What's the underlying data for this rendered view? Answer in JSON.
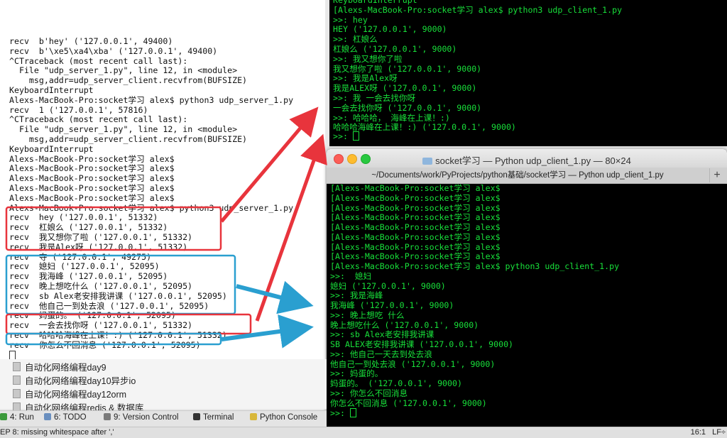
{
  "server": {
    "lines": [
      "recv  b'hey' ('127.0.0.1', 49400)",
      "recv  b'\\xe5\\xa4\\xba' ('127.0.0.1', 49400)",
      "^CTraceback (most recent call last):",
      "  File \"udp_server_1.py\", line 12, in <module>",
      "    msg,addr=udp_server_client.recvfrom(BUFSIZE)",
      "KeyboardInterrupt",
      "Alexs-MacBook-Pro:socket学习 alex$ python3 udp_server_1.py",
      "recv  1 ('127.0.0.1', 57816)",
      "^CTraceback (most recent call last):",
      "  File \"udp_server_1.py\", line 12, in <module>",
      "    msg,addr=udp_server_client.recvfrom(BUFSIZE)",
      "KeyboardInterrupt",
      "Alexs-MacBook-Pro:socket学习 alex$",
      "Alexs-MacBook-Pro:socket学习 alex$",
      "Alexs-MacBook-Pro:socket学习 alex$",
      "Alexs-MacBook-Pro:socket学习 alex$",
      "Alexs-MacBook-Pro:socket学习 alex$",
      "Alexs-MacBook-Pro:socket学习 alex$ python3 udp_server_1.py",
      "recv  hey ('127.0.0.1', 51332)",
      "recv  杠娘么 ('127.0.0.1', 51332)",
      "recv  我又想你了啦 ('127.0.0.1', 51332)",
      "recv  我是Alex呀 ('127.0.0.1', 51332)",
      "recv  夺 ('127.0.0.1', 49275)",
      "recv  媳妇 ('127.0.0.1', 52095)",
      "recv  我海峰 ('127.0.0.1', 52095)",
      "recv  晚上想吃什么 ('127.0.0.1', 52095)",
      "recv  sb Alex老安排我讲课 ('127.0.0.1', 52095)",
      "recv  他自己一到处去浪 ('127.0.0.1', 52095)",
      "recv  妈蛋的。 ('127.0.0.1', 52095)",
      "recv  一会去找你呀 ('127.0.0.1', 51332)",
      "recv  哈哈哈海峰在上课！:) ('127.0.0.1', 51332)",
      "recv  你怎么不回消息 ('127.0.0.1', 52095)"
    ]
  },
  "client1": {
    "lines": [
      "KeyboardInterrupt",
      "[Alexs-MacBook-Pro:socket学习 alex$ python3 udp_client_1.py",
      ">>: hey",
      "HEY ('127.0.0.1', 9000)",
      ">>: 杠娘么",
      "杠娘么 ('127.0.0.1', 9000)",
      ">>: 我又想你了啦",
      "我又想你了啦 ('127.0.0.1', 9000)",
      ">>: 我是Alex呀",
      "我是ALEX呀 ('127.0.0.1', 9000)",
      ">>: 我 一会去找你呀",
      "一会去找你呀 ('127.0.0.1', 9000)",
      ">>: 哈哈哈， 海峰在上课！:)",
      "哈哈哈海峰在上课！:) ('127.0.0.1', 9000)"
    ],
    "prompt": ">>: "
  },
  "client2": {
    "title": "socket学习 — Python udp_client_1.py — 80×24",
    "tab": "~/Documents/work/PyProjects/python基础/socket学习 — Python udp_client_1.py",
    "plus": "+",
    "lines": [
      "[Alexs-MacBook-Pro:socket学习 alex$",
      "[Alexs-MacBook-Pro:socket学习 alex$",
      "[Alexs-MacBook-Pro:socket学习 alex$",
      "[Alexs-MacBook-Pro:socket学习 alex$",
      "[Alexs-MacBook-Pro:socket学习 alex$",
      "[Alexs-MacBook-Pro:socket学习 alex$",
      "[Alexs-MacBook-Pro:socket学习 alex$",
      "[Alexs-MacBook-Pro:socket学习 alex$",
      "[Alexs-MacBook-Pro:socket学习 alex$ python3 udp_client_1.py",
      ">>:  媳妇",
      "媳妇 ('127.0.0.1', 9000)",
      ">>: 我是海峰",
      "我海峰 ('127.0.0.1', 9000)",
      ">>: 晚上想吃 什么",
      "晚上想吃什么 ('127.0.0.1', 9000)",
      ">>: sb Alex老安排我讲课",
      "SB ALEX老安排我讲课 ('127.0.0.1', 9000)",
      ">>: 他自己一天去到处去浪",
      "他自己一到处去浪 ('127.0.0.1', 9000)",
      ">>: 妈蛋的。",
      "妈蛋的。 ('127.0.0.1', 9000)",
      ">>: 你怎么不回消息",
      "你怎么不回消息 ('127.0.0.1', 9000)",
      ">>: "
    ]
  },
  "tree": {
    "items": [
      "自动化网络编程day9",
      "自动化网络编程day10异步io",
      "自动化网络编程day12orm",
      "自动化网络编程redis & 数据库"
    ]
  },
  "toolbar": {
    "run": "4: Run",
    "todo": "6: TODO",
    "vcs": "9: Version Control",
    "terminal": "Terminal",
    "console": "Python Console"
  },
  "statusbar": {
    "message": "EP 8: missing whitespace after ','",
    "position": "16:1",
    "encoding": "LF÷"
  },
  "colors": {
    "terminal_green": "#18e03a",
    "annotation_red": "#e8343c",
    "annotation_blue": "#2a9fd0"
  }
}
